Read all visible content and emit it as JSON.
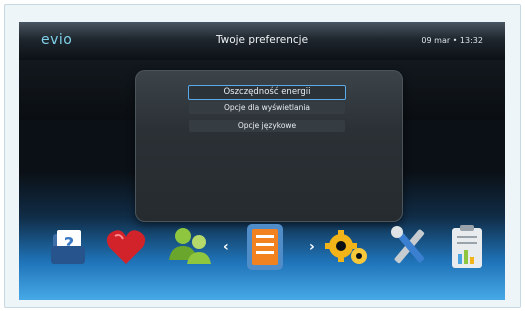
{
  "header": {
    "logo": "evio",
    "title": "Twoje preferencje",
    "datetime": "09 mar • 13:32"
  },
  "menu": {
    "items": [
      {
        "label": "Oszczędność energii",
        "selected": true
      },
      {
        "label": "Opcje dla wyświetlania",
        "selected": false
      },
      {
        "label": "Opcje językowe",
        "selected": false
      }
    ]
  },
  "carousel": {
    "icons": [
      "help-folder-icon",
      "heart-icon",
      "users-icon",
      "preferences-clipboard-icon",
      "gears-icon",
      "tools-icon",
      "report-clipboard-icon"
    ],
    "prev_arrow": "‹",
    "next_arrow": "›"
  },
  "colors": {
    "accent": "#5aa9e8",
    "logo": "#7fd1ec"
  }
}
